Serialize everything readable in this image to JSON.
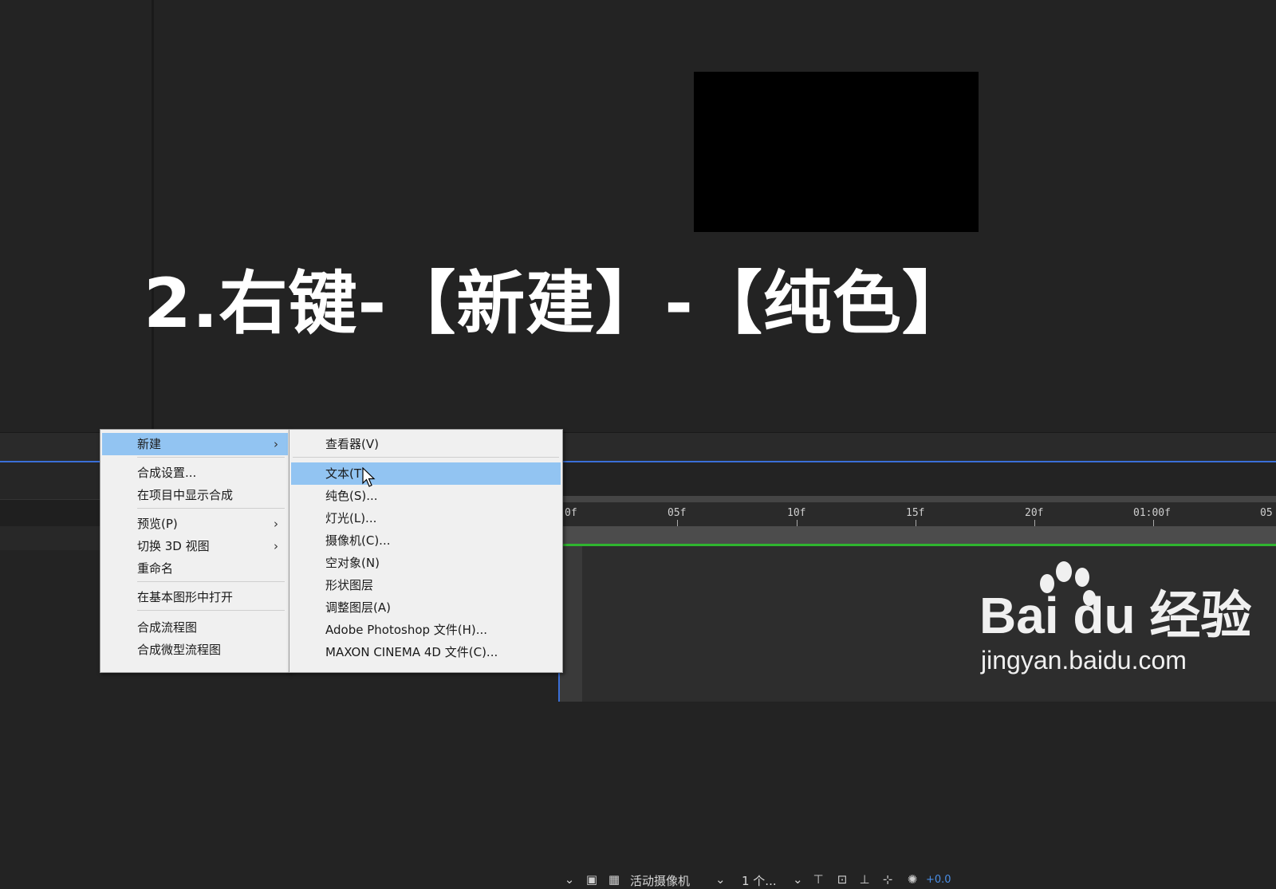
{
  "overlay_title": "2.右键-【新建】-【纯色】",
  "context_menu": {
    "items": [
      {
        "label": "新建",
        "submenu": true,
        "highlighted": true
      },
      {
        "label": "合成设置..."
      },
      {
        "label": "在项目中显示合成"
      },
      {
        "label": "预览(P)",
        "submenu": true
      },
      {
        "label": "切换 3D 视图",
        "submenu": true
      },
      {
        "label": "重命名"
      },
      {
        "label": "在基本图形中打开"
      },
      {
        "label": "合成流程图"
      },
      {
        "label": "合成微型流程图"
      }
    ]
  },
  "submenu": {
    "items": [
      {
        "label": "查看器(V)"
      },
      {
        "label": "文本(T)",
        "highlighted": true
      },
      {
        "label": "纯色(S)..."
      },
      {
        "label": "灯光(L)..."
      },
      {
        "label": "摄像机(C)..."
      },
      {
        "label": "空对象(N)"
      },
      {
        "label": "形状图层"
      },
      {
        "label": "调整图层(A)"
      },
      {
        "label": "Adobe Photoshop 文件(H)..."
      },
      {
        "label": "MAXON CINEMA 4D 文件(C)..."
      }
    ]
  },
  "toolbar": {
    "camera_select": "活动摄像机",
    "views_select": "1 个...",
    "exposure_value": "+0.0",
    "submenu_arrow": "›",
    "dropdown_arrow": "⌄"
  },
  "timeline": {
    "ticks": [
      "0f",
      "05f",
      "10f",
      "15f",
      "20f",
      "01:00f",
      "05"
    ]
  },
  "watermark": {
    "logo": "Bai du 经验",
    "url": "jingyan.baidu.com"
  },
  "colors": {
    "menu_highlight": "#92c4f2",
    "timeline_green": "#2fb52f",
    "accent_blue": "#3a6fd8"
  }
}
